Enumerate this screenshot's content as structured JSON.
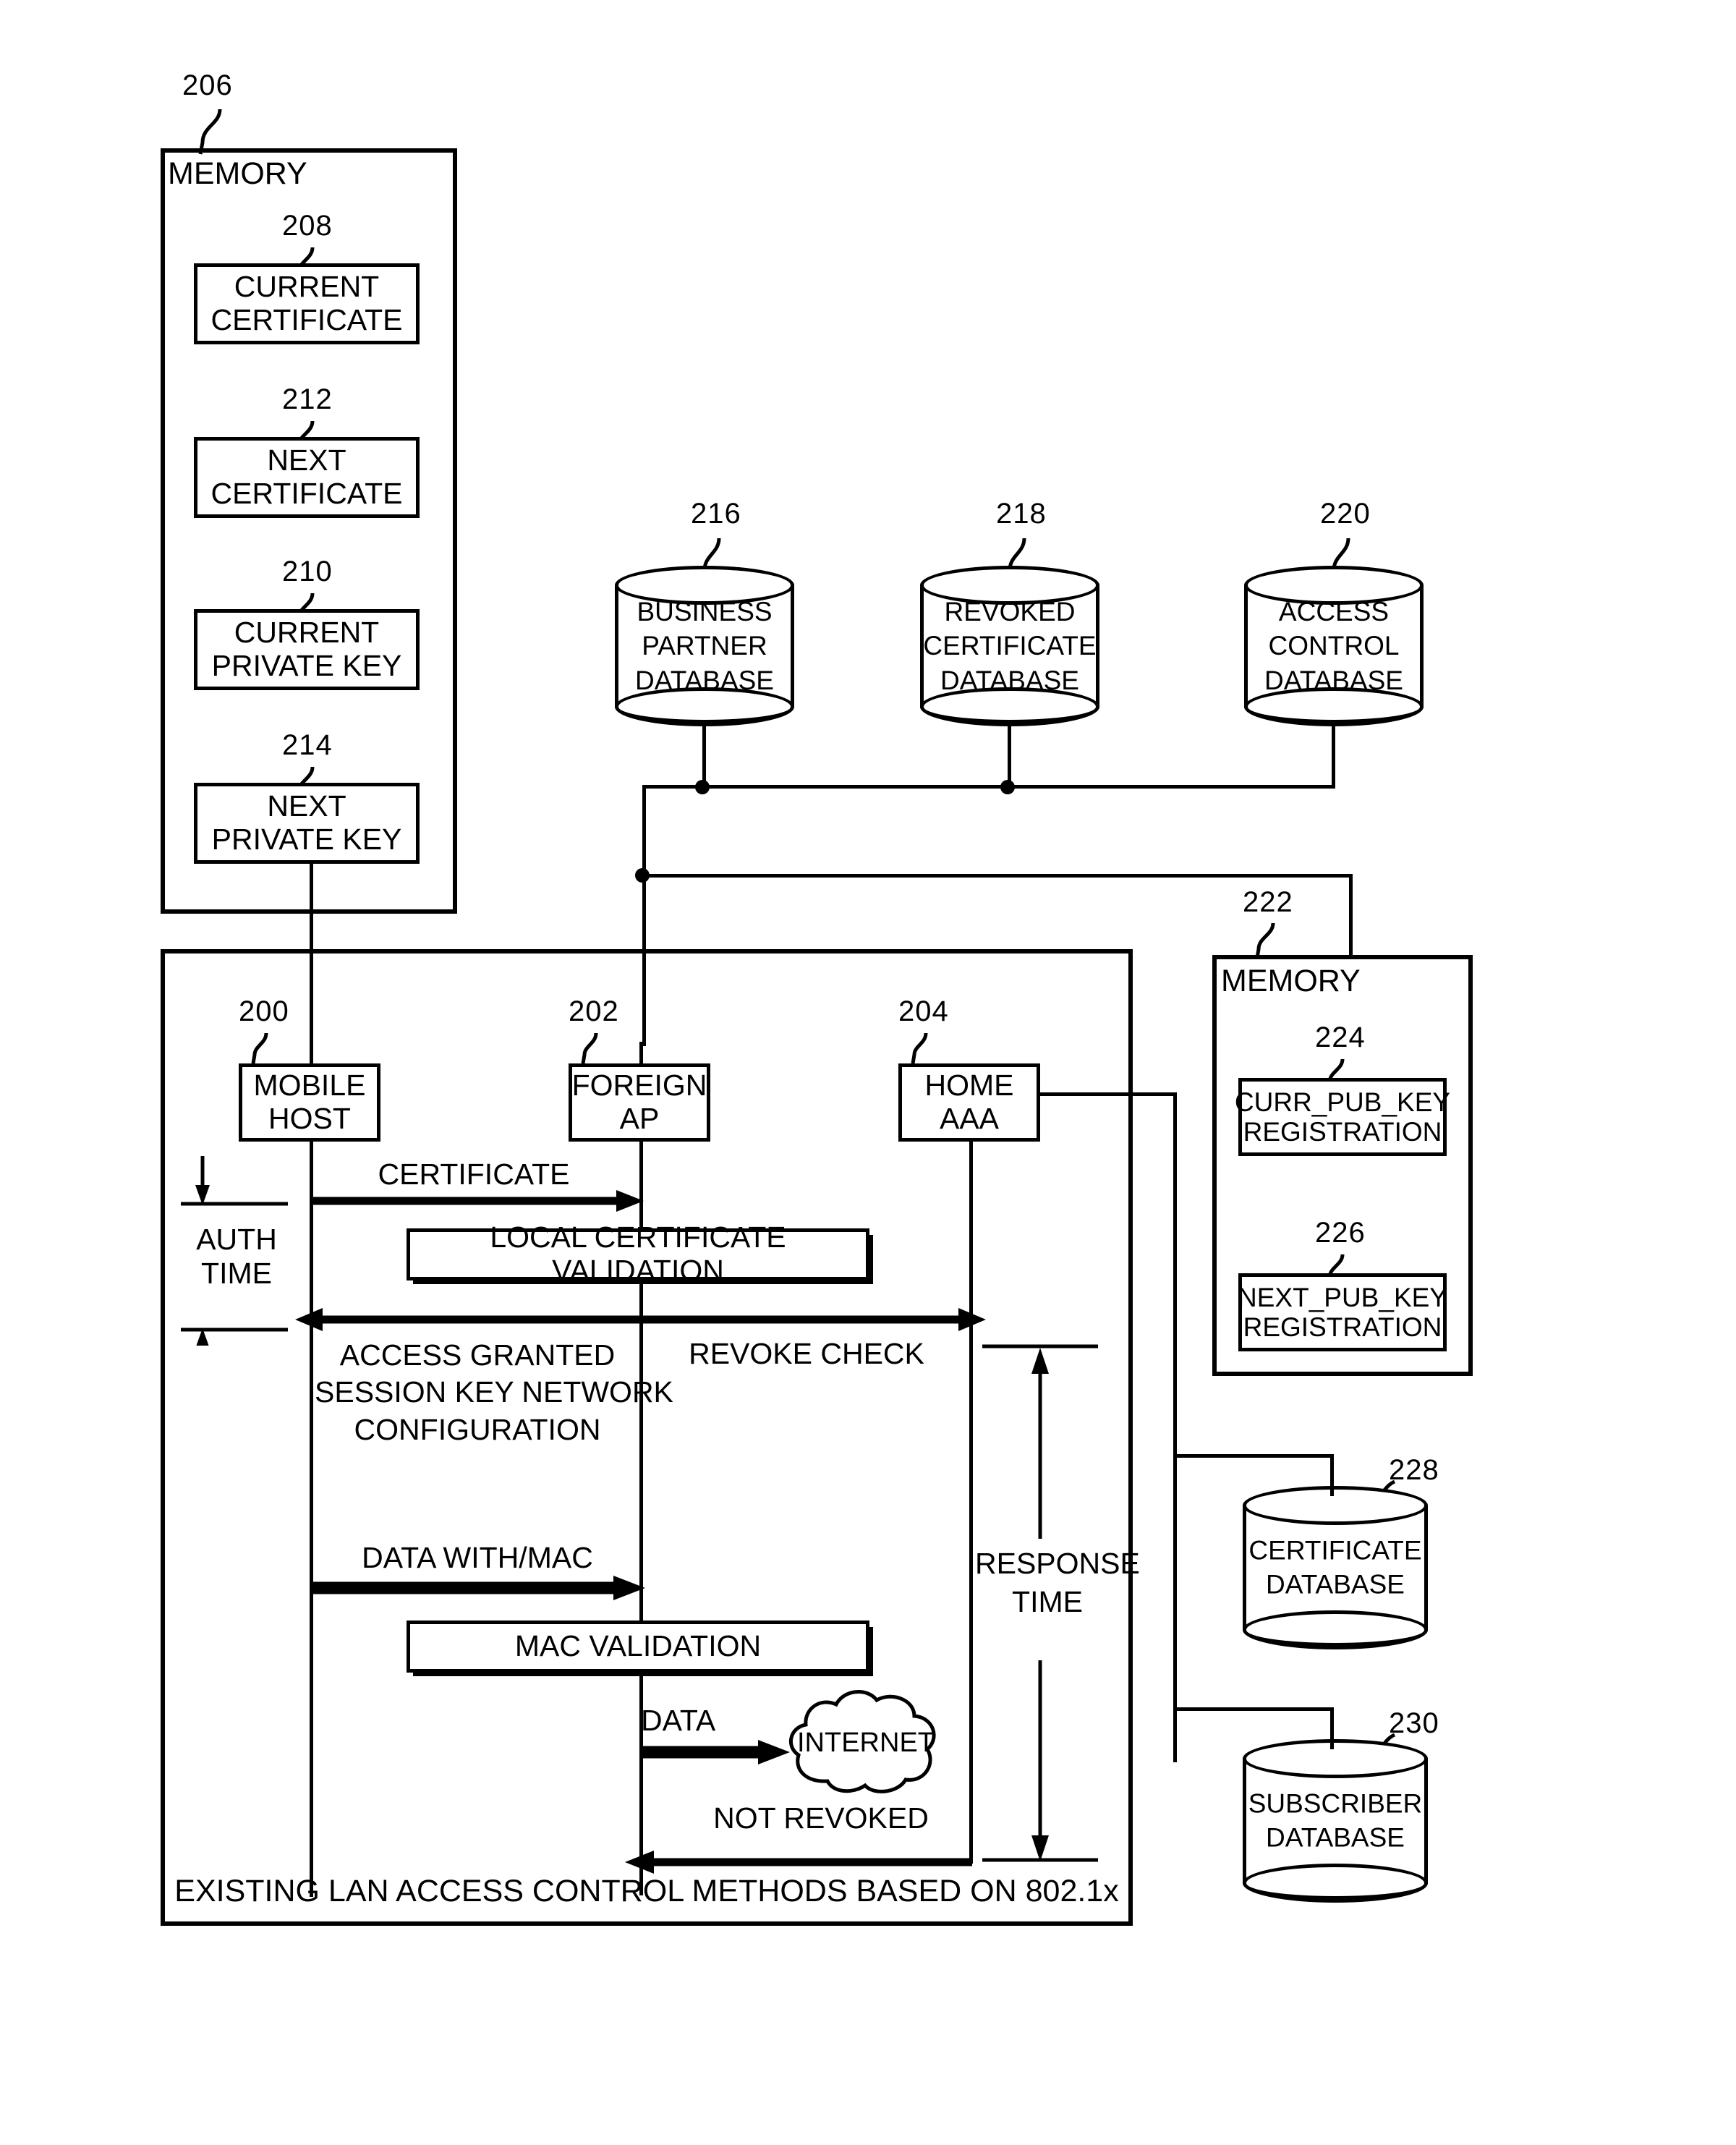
{
  "figure": {
    "caption": "EXISTING LAN ACCESS CONTROL METHODS BASED ON 802.1x"
  },
  "memory_mobile": {
    "ref": "206",
    "title": "MEMORY",
    "items": [
      {
        "ref": "208",
        "label": "CURRENT\nCERTIFICATE"
      },
      {
        "ref": "212",
        "label": "NEXT\nCERTIFICATE"
      },
      {
        "ref": "210",
        "label": "CURRENT\nPRIVATE KEY"
      },
      {
        "ref": "214",
        "label": "NEXT\nPRIVATE KEY"
      }
    ]
  },
  "top_databases": [
    {
      "ref": "216",
      "label": "BUSINESS\nPARTNER\nDATABASE"
    },
    {
      "ref": "218",
      "label": "REVOKED\nCERTIFICATE\nDATABASE"
    },
    {
      "ref": "220",
      "label": "ACCESS\nCONTROL\nDATABASE"
    }
  ],
  "memory_aaa": {
    "ref": "222",
    "title": "MEMORY",
    "items": [
      {
        "ref": "224",
        "label": "CURR_PUB_KEY\nREGISTRATION"
      },
      {
        "ref": "226",
        "label": "NEXT_PUB_KEY\nREGISTRATION"
      }
    ]
  },
  "side_databases": [
    {
      "ref": "228",
      "label": "CERTIFICATE\nDATABASE"
    },
    {
      "ref": "230",
      "label": "SUBSCRIBER\nDATABASE"
    }
  ],
  "actors": [
    {
      "ref": "200",
      "label": "MOBILE\nHOST"
    },
    {
      "ref": "202",
      "label": "FOREIGN\nAP"
    },
    {
      "ref": "204",
      "label": "HOME\nAAA"
    }
  ],
  "messages": [
    {
      "label": "CERTIFICATE"
    },
    {
      "label": "ACCESS GRANTED\nSESSION KEY NETWORK\nCONFIGURATION"
    },
    {
      "label": "REVOKE CHECK"
    },
    {
      "label": "DATA WITH/MAC"
    },
    {
      "label": "DATA"
    },
    {
      "label": "NOT REVOKED"
    }
  ],
  "activities": [
    {
      "label": "LOCAL CERTIFICATE VALIDATION"
    },
    {
      "label": "MAC VALIDATION"
    }
  ],
  "timing": [
    {
      "label": "AUTH\nTIME"
    },
    {
      "label": "RESPONSE\nTIME"
    }
  ],
  "cloud": {
    "label": "INTERNET"
  }
}
